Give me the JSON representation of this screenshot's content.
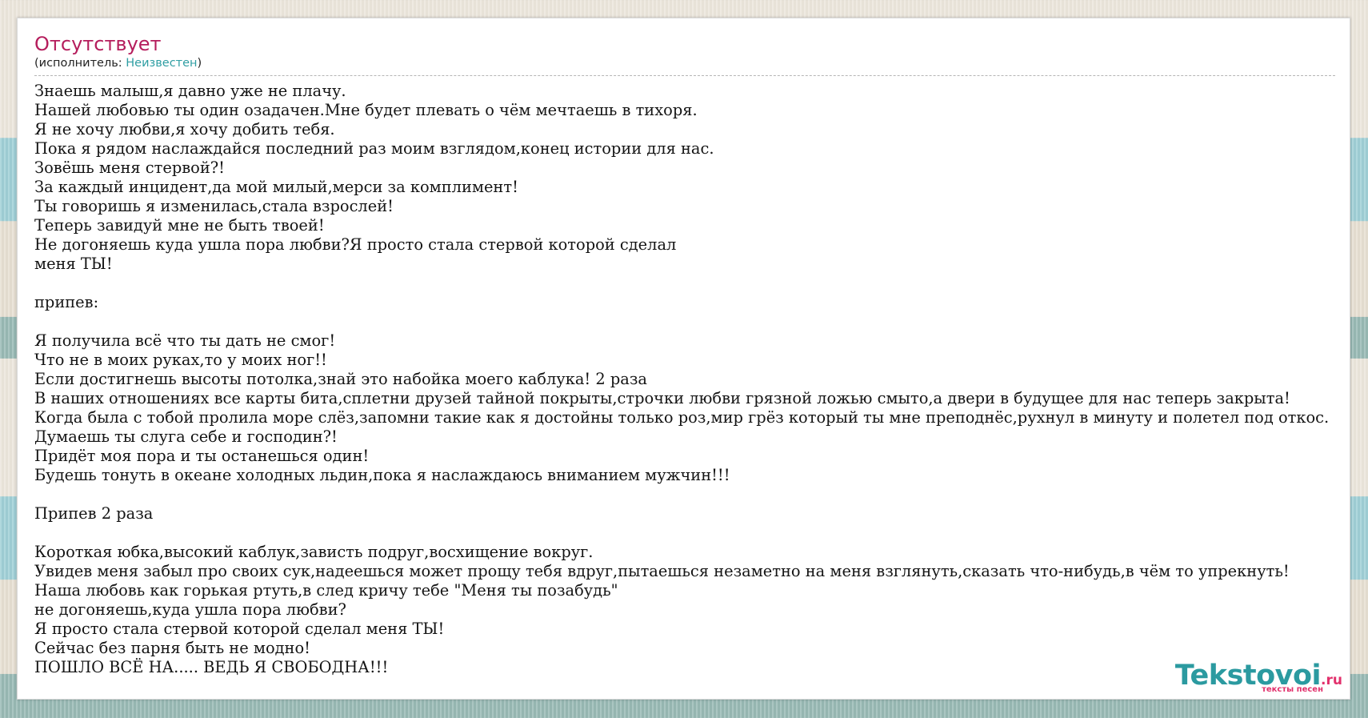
{
  "song": {
    "title": "Отсутствует",
    "artist_prefix": "(исполнитель: ",
    "artist_name": "Неизвестен",
    "artist_suffix": ")"
  },
  "lyrics": [
    "Знаешь малыш,я давно уже не плачу.",
    "Нашей любовью ты один озадачен.Мне будет плевать о чём мечтаешь в тихоря.",
    "Я не хочу любви,я хочу добить тебя.",
    "Пока я рядом наслаждайся последний раз моим взглядом,конец истории для нас.",
    "Зовёшь меня стервой?!",
    "За каждый инцидент,да мой милый,мерси за комплимент!",
    "Ты говоришь я изменилась,стала взрослей!",
    "Теперь завидуй мне не быть твоей!",
    "Не догоняешь куда ушла пора любви?Я просто стала стервой которой сделал",
    "меня ТЫ!",
    "",
    "припев:",
    "",
    "Я получила всё что ты дать не смог!",
    "Что не в моих руках,то у моих ног!!",
    "Если достигнешь высоты потолка,знай это набойка моего каблука! 2 раза",
    "В наших отношениях все карты бита,сплетни друзей тайной покрыты,строчки любви грязной ложью смыто,а двери в будущее для нас теперь закрыта!",
    "Когда была с тобой пролила море слёз,запомни такие как я достойны только роз,мир грёз который ты мне преподнёс,рухнул в минуту и полетел под откос.",
    "Думаешь ты слуга себе и господин?!",
    "Придёт моя пора и ты останешься один!",
    "Будешь тонуть в океане холодных льдин,пока я наслаждаюсь вниманием мужчин!!!",
    "",
    "Припев 2 раза",
    "",
    "Короткая юбка,высокий каблук,зависть подруг,восхищение вокруг.",
    "Увидев меня забыл про своих сук,надеешься может прощу тебя вдруг,пытаешься незаметно на меня взглянуть,сказать что-нибудь,в чём то упрекнуть!",
    "Наша любовь как горькая ртуть,в след кричу тебе \"Меня ты позабудь\"",
    "не догоняешь,куда ушла пора любви?",
    "Я просто стала стервой которой сделал меня ТЫ!",
    "Сейчас без парня быть не модно!",
    "ПОШЛО ВСЁ НА..... ВЕДЬ Я СВОБОДНА!!!"
  ],
  "logo": {
    "name": "Tekstovoi",
    "tld": ".ru",
    "tagline": "тексты песен"
  },
  "colors": {
    "title": "#b51d5c",
    "artist_link": "#2f9ea3",
    "logo_main": "#2b9aa0",
    "logo_accent": "#e2306c"
  }
}
